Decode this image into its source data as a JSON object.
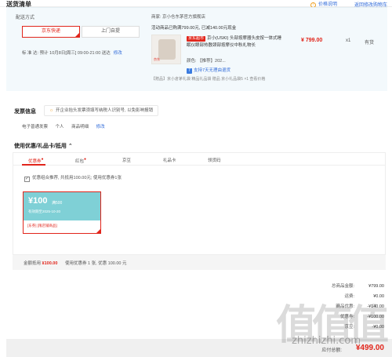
{
  "header": {
    "title": "送货清单",
    "price_info_link": "价格说明",
    "return_to_cart_link": "返回修改购物车"
  },
  "shipping": {
    "label": "配送方式",
    "options": [
      "京东快递",
      "上门自提"
    ],
    "selected": "京东快递",
    "time_text": "标 准 达:  预计 10月8日[周三] 09:00-21:00 送达",
    "modify_link": "修改"
  },
  "order_item": {
    "shop": "商家:  京小仓东茅官方旗舰店",
    "promo": "活动商品已购满799.00元, 已减140.00元现金",
    "image_tag": "京东",
    "badge": "京东超市",
    "name": "京小(USKI) 头部按摩器头皮按一体式睡眠仪眼部热敷颈部按摩仪中秋礼物长",
    "color": "颜色: 【推荐】202...",
    "return_policy": "支持7天无理由退货",
    "gifts": "【赠品】京小倉茅礼袋 精品礼品袋 赠品 京小礼品袋5 ×1  查看价格",
    "gift_link": "查看价格",
    "price": "¥ 799.00",
    "qty": "x1",
    "stock": "有货"
  },
  "invoice": {
    "title": "发票信息",
    "tip": "开企业抬头发票须填写纳税人识别号, 以免影响报销",
    "items": [
      "电子普通发票",
      "个人",
      "商品明细"
    ],
    "modify_link": "修改"
  },
  "coupons": {
    "title": "使用优惠/礼品卡/抵用",
    "tabs": [
      "优惠券",
      "红包",
      "京豆",
      "礼品卡",
      "领货码"
    ],
    "active_tab": "优惠券",
    "auto_check": "优惠组合推荐, 共抵用100.00元; 使用优惠券1张",
    "coupon": {
      "amount": "¥100",
      "condition": "满500",
      "validity": "有效期至2025-10-20",
      "scope": "[东券] [限店铺商品]"
    },
    "summary_label": "金额抵用",
    "summary_amount": "¥100.00",
    "summary_text": "使用优惠券 1 张, 优惠 100.00 元"
  },
  "totals": {
    "rows": [
      {
        "label": "总商品金额:",
        "value": "¥799.00"
      },
      {
        "label": "运费:",
        "value": "¥0.00"
      },
      {
        "label": "商品优惠:",
        "value": "-¥140.00"
      },
      {
        "label": "优惠券:",
        "value": "-¥100.00"
      },
      {
        "label": "京豆:",
        "value": "-¥0.00"
      }
    ],
    "pay_label": "应付总额:",
    "pay_amount": "¥499.00"
  },
  "watermark": {
    "big": "值值值",
    "url": "zhizhizhi.com"
  },
  "colors": {
    "accent": "#e1251b",
    "link": "#2f6ad9",
    "coupon_bg": "#7fd0d6",
    "panel_bg": "#f3f9fc"
  }
}
